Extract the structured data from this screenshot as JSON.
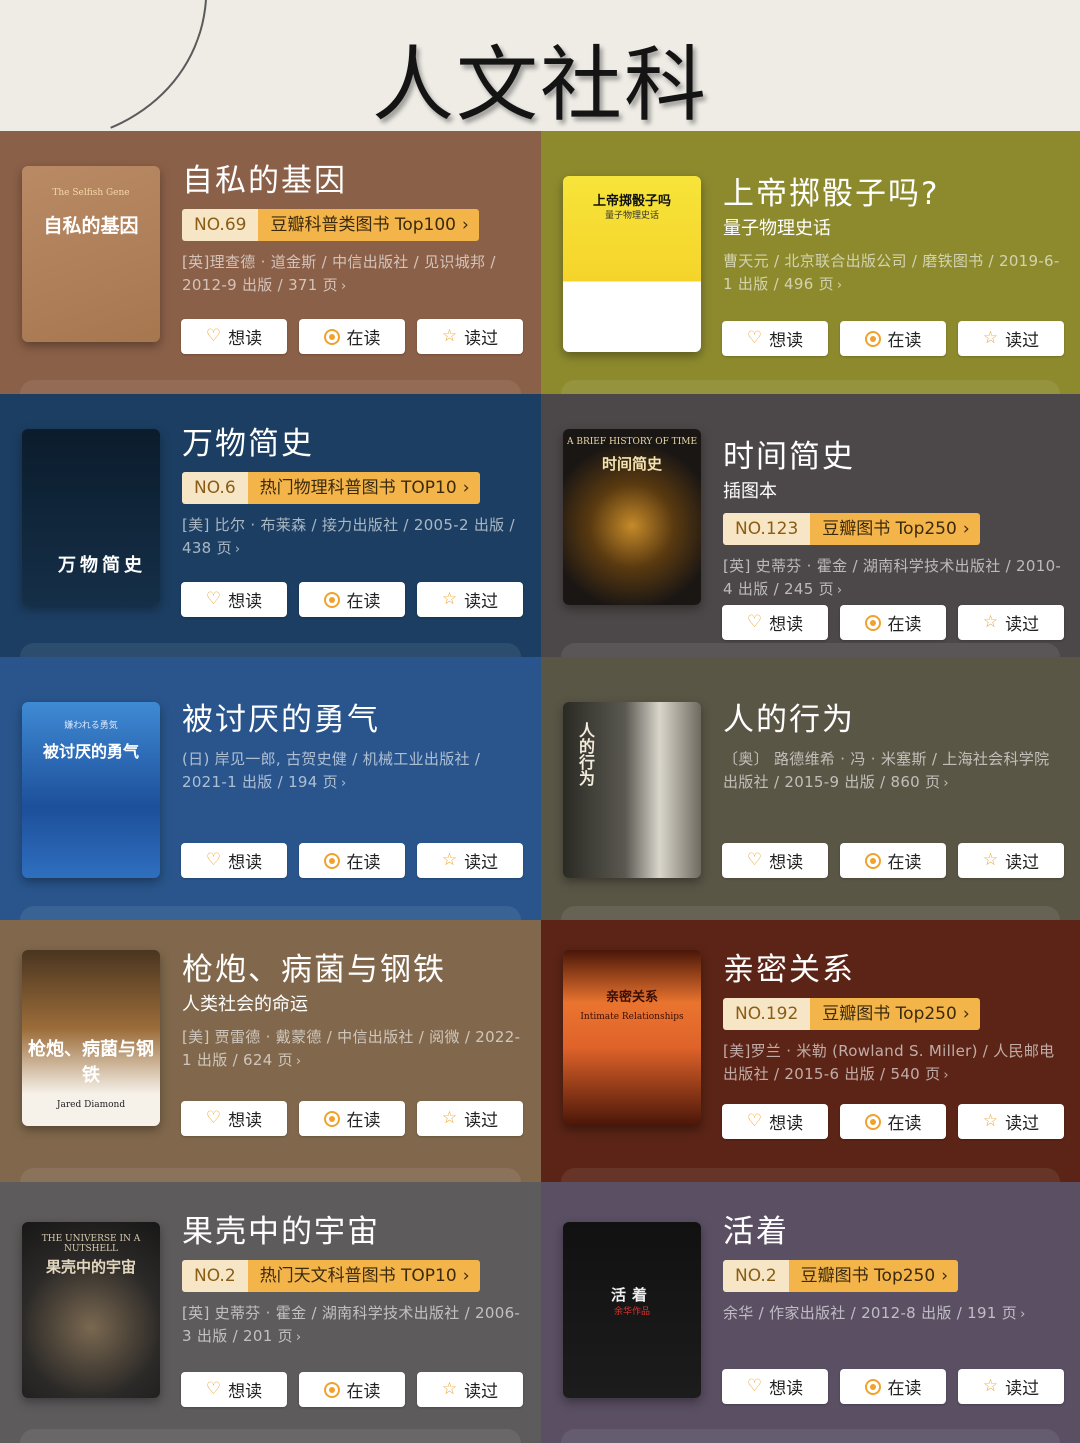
{
  "header": {
    "title": "人文社科"
  },
  "buttons": {
    "want": "想读",
    "reading": "在读",
    "read": "读过"
  },
  "books": [
    {
      "title": "自私的基因",
      "subtitle": "",
      "rank_no": "NO.69",
      "rank_list": "豆瓣科普类图书 Top100",
      "meta": "[英]理查德 · 道金斯 / 中信出版社 / 见识城邦 / 2012-9 出版 / 371 页",
      "cover_title": "自私的基因",
      "cover_sub": "The Selfish Gene",
      "color": "#8b6048"
    },
    {
      "title": "上帝掷骰子吗?",
      "subtitle": "量子物理史话",
      "rank_no": "",
      "rank_list": "",
      "meta": "曹天元 / 北京联合出版公司 / 磨铁图书 / 2019-6-1 出版 / 496 页",
      "cover_title": "上帝掷骰子吗",
      "cover_sub": "量子物理史话",
      "color": "#8d8a2e"
    },
    {
      "title": "万物简史",
      "subtitle": "",
      "rank_no": "NO.6",
      "rank_list": "热门物理科普图书 TOP10",
      "meta": "[美] 比尔 · 布莱森 / 接力出版社 / 2005-2 出版 / 438 页",
      "cover_title": "万物简史",
      "cover_sub": "",
      "color": "#1c3e62"
    },
    {
      "title": "时间简史",
      "subtitle": "插图本",
      "rank_no": "NO.123",
      "rank_list": "豆瓣图书 Top250",
      "meta": "[英] 史蒂芬 · 霍金 / 湖南科学技术出版社 / 2010-4 出版 / 245 页",
      "cover_title": "时间简史",
      "cover_sub": "A BRIEF HISTORY OF TIME",
      "color": "#4c4748"
    },
    {
      "title": "被讨厌的勇气",
      "subtitle": "",
      "rank_no": "",
      "rank_list": "",
      "meta": "(日) 岸见一郎, 古贺史健 / 机械工业出版社 / 2021-1 出版 / 194 页",
      "cover_title": "被讨厌的勇气",
      "cover_sub": "嫌われる勇気",
      "color": "#29558c"
    },
    {
      "title": "人的行为",
      "subtitle": "",
      "rank_no": "",
      "rank_list": "",
      "meta": "〔奥〕 路德维希 · 冯 · 米塞斯 / 上海社会科学院出版社 / 2015-9 出版 / 860 页",
      "cover_title": "人的行为",
      "cover_sub": "",
      "color": "#5a5646"
    },
    {
      "title": "枪炮、病菌与钢铁",
      "subtitle": "人类社会的命运",
      "rank_no": "",
      "rank_list": "",
      "meta": "[美] 贾雷德 · 戴蒙德 / 中信出版社 / 阅微 / 2022-1 出版 / 624 页",
      "cover_title": "枪炮、病菌与钢铁",
      "cover_sub": "Jared Diamond",
      "color": "#81684c"
    },
    {
      "title": "亲密关系",
      "subtitle": "",
      "rank_no": "NO.192",
      "rank_list": "豆瓣图书 Top250",
      "meta": "[美]罗兰 · 米勒 (Rowland S. Miller) / 人民邮电出版社 / 2015-6 出版 / 540 页",
      "cover_title": "亲密关系",
      "cover_sub": "Intimate Relationships",
      "color": "#5b2416"
    },
    {
      "title": "果壳中的宇宙",
      "subtitle": "",
      "rank_no": "NO.2",
      "rank_list": "热门天文科普图书 TOP10",
      "meta": "[英] 史蒂芬 · 霍金 / 湖南科学技术出版社 / 2006-3 出版 / 201 页",
      "cover_title": "果壳中的宇宙",
      "cover_sub": "THE UNIVERSE IN A NUTSHELL",
      "color": "#5e5b5c"
    },
    {
      "title": "活着",
      "subtitle": "",
      "rank_no": "NO.2",
      "rank_list": "豆瓣图书 Top250",
      "meta": "余华 / 作家出版社 / 2012-8 出版 / 191 页",
      "cover_title": "活着",
      "cover_sub": "余华作品",
      "color": "#5a4f63"
    }
  ]
}
